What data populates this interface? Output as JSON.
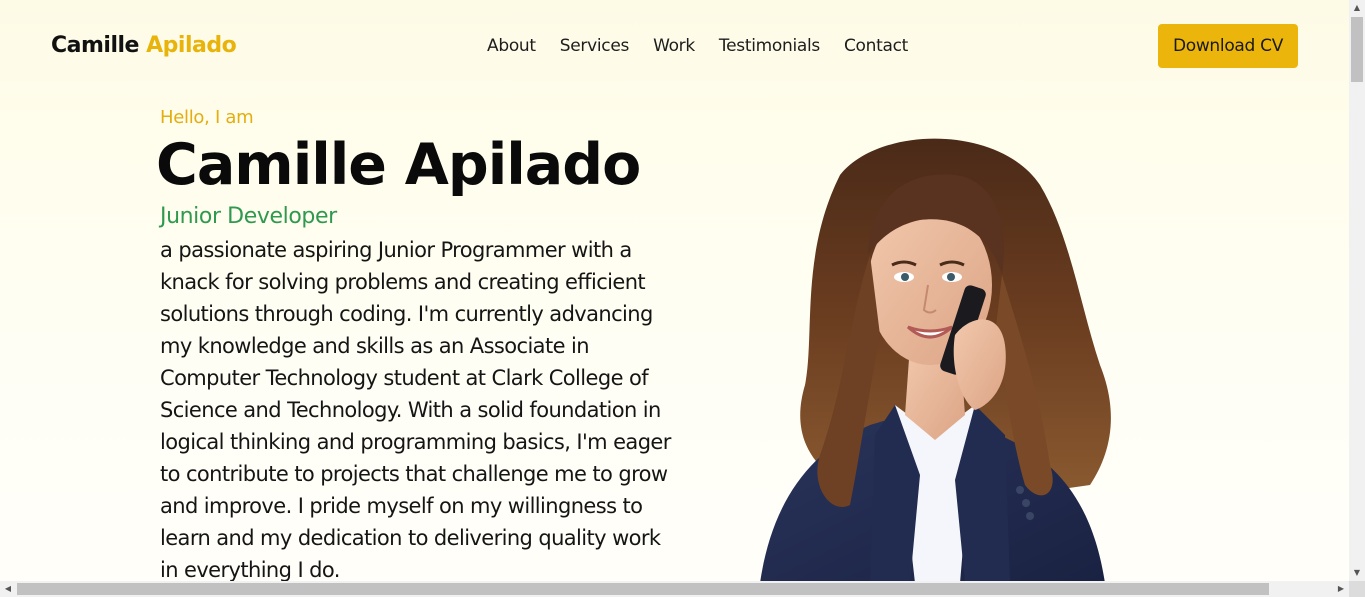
{
  "header": {
    "brand_first": "Camille",
    "brand_last": "Apilado",
    "nav": [
      "About",
      "Services",
      "Work",
      "Testimonials",
      "Contact"
    ],
    "cta_label": "Download CV"
  },
  "hero": {
    "greeting": "Hello, I am",
    "name": "Camille Apilado",
    "role": "Junior Developer",
    "bio": "a passionate aspiring Junior Programmer with a knack for solving problems and creating efficient solutions through coding. I'm currently advancing my knowledge and skills as an Associate in Computer Technology student at Clark College of Science and Technology. With a solid foundation in logical thinking and programming basics, I'm eager to contribute to projects that challenge me to grow and improve. I pride myself on my willingness to learn and my dedication to delivering quality work in everything I do."
  },
  "colors": {
    "accent": "#ebb50c",
    "role": "#2f9a4f",
    "background": "#fffdeb"
  },
  "icons": {
    "scroll_up": "triangle-up",
    "scroll_down": "triangle-down",
    "scroll_left": "triangle-left",
    "scroll_right": "triangle-right"
  }
}
